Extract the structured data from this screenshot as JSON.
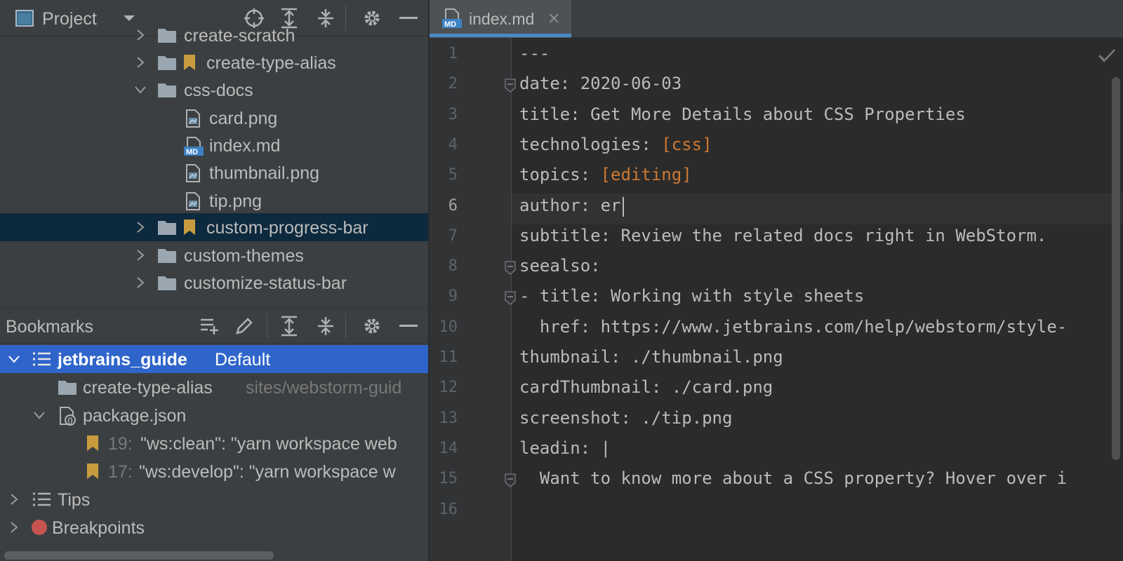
{
  "project": {
    "title": "Project",
    "items": [
      {
        "label": "create-scratch"
      },
      {
        "label": "create-type-alias"
      },
      {
        "label": "css-docs"
      },
      {
        "label": "card.png"
      },
      {
        "label": "index.md"
      },
      {
        "label": "thumbnail.png"
      },
      {
        "label": "tip.png"
      },
      {
        "label": "custom-progress-bar"
      },
      {
        "label": "custom-themes"
      },
      {
        "label": "customize-status-bar"
      }
    ]
  },
  "bookmarks": {
    "title": "Bookmarks",
    "items": [
      {
        "label": "jetbrains_guide",
        "sub": "Default"
      },
      {
        "label": "create-type-alias",
        "sub": "sites/webstorm-guid"
      },
      {
        "label": "package.json"
      },
      {
        "line": "19:",
        "label": "\"ws:clean\": \"yarn workspace web"
      },
      {
        "line": "17:",
        "label": "\"ws:develop\": \"yarn workspace w"
      },
      {
        "label": "Tips"
      },
      {
        "label": "Breakpoints"
      }
    ]
  },
  "editor": {
    "tab_label": "index.md",
    "tab_icon_text": "MD",
    "current_line": 6,
    "lines": [
      {
        "n": "1",
        "parts": [
          {
            "t": "---"
          }
        ]
      },
      {
        "n": "2",
        "parts": [
          {
            "t": "date: 2020-06-03"
          }
        ]
      },
      {
        "n": "3",
        "parts": [
          {
            "t": "title: Get More Details about CSS Properties"
          }
        ]
      },
      {
        "n": "4",
        "parts": [
          {
            "t": "technologies: "
          },
          {
            "t": "[css]",
            "s": true
          }
        ]
      },
      {
        "n": "5",
        "parts": [
          {
            "t": "topics: "
          },
          {
            "t": "[editing]",
            "s": true
          }
        ]
      },
      {
        "n": "6",
        "parts": [
          {
            "t": "author: er"
          }
        ]
      },
      {
        "n": "7",
        "parts": [
          {
            "t": "subtitle: Review the related docs right in WebStorm."
          }
        ]
      },
      {
        "n": "8",
        "parts": [
          {
            "t": "seealso:"
          }
        ]
      },
      {
        "n": "9",
        "parts": [
          {
            "t": "- title: Working with style sheets"
          }
        ]
      },
      {
        "n": "10",
        "parts": [
          {
            "t": "  href: https://www.jetbrains.com/help/webstorm/style-"
          }
        ]
      },
      {
        "n": "11",
        "parts": [
          {
            "t": "thumbnail: ./thumbnail.png"
          }
        ]
      },
      {
        "n": "12",
        "parts": [
          {
            "t": "cardThumbnail: ./card.png"
          }
        ]
      },
      {
        "n": "13",
        "parts": [
          {
            "t": "screenshot: ./tip.png"
          }
        ]
      },
      {
        "n": "14",
        "parts": [
          {
            "t": "leadin: |"
          }
        ]
      },
      {
        "n": "15",
        "parts": [
          {
            "t": "  Want to know more about a CSS property? Hover over i"
          }
        ]
      },
      {
        "n": "16",
        "parts": [
          {
            "t": ""
          }
        ]
      }
    ]
  },
  "colors": {
    "panel_bg": "#3c3f41",
    "editor_bg": "#2b2b2b",
    "selection_blue": "#2f65ca",
    "selection_dark": "#0d293e",
    "yaml_string": "#cc7832",
    "bookmark": "#c89c3e"
  }
}
